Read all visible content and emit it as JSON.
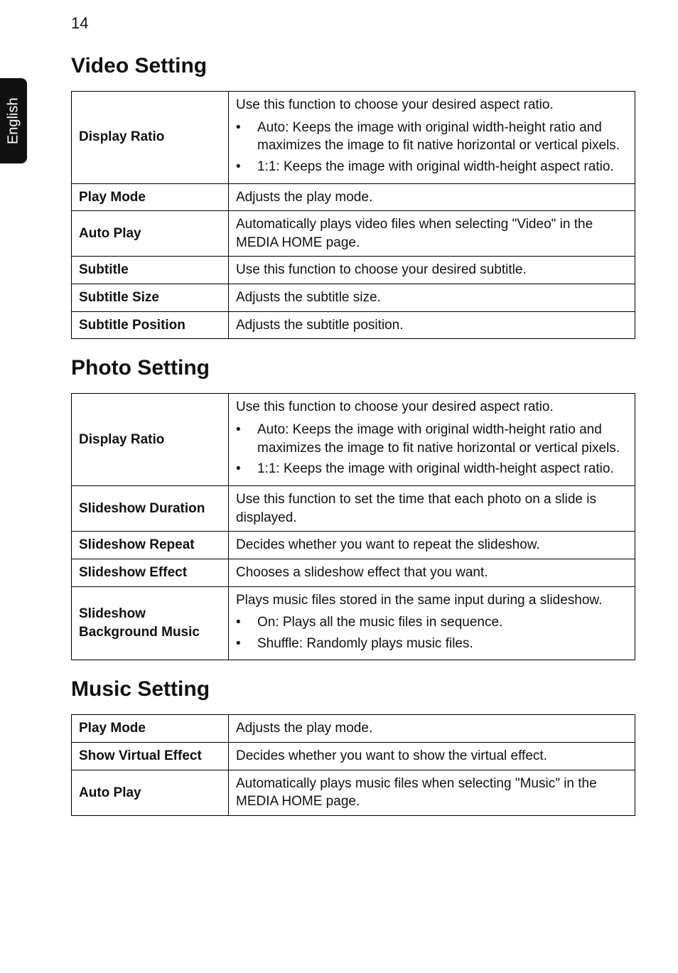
{
  "page_number": "14",
  "side_tab": "English",
  "sections": {
    "video": {
      "heading": "Video Setting",
      "rows": {
        "display_ratio": {
          "label": "Display Ratio",
          "intro": "Use this function to choose your desired aspect ratio.",
          "bullet1": "Auto: Keeps the image with original width-height ratio and maximizes the image to fit native horizontal or vertical pixels.",
          "bullet2": "1:1: Keeps the image with original width-height aspect ratio."
        },
        "play_mode": {
          "label": "Play Mode",
          "desc": "Adjusts the play mode."
        },
        "auto_play": {
          "label": "Auto Play",
          "desc": "Automatically plays video files when selecting \"Video\" in the MEDIA HOME page."
        },
        "subtitle": {
          "label": "Subtitle",
          "desc": "Use this function to choose your desired subtitle."
        },
        "subtitle_size": {
          "label": "Subtitle Size",
          "desc": "Adjusts the subtitle size."
        },
        "subtitle_position": {
          "label": "Subtitle Position",
          "desc": "Adjusts the subtitle position."
        }
      }
    },
    "photo": {
      "heading": "Photo Setting",
      "rows": {
        "display_ratio": {
          "label": "Display Ratio",
          "intro": "Use this function to choose your desired aspect ratio.",
          "bullet1": "Auto: Keeps the image with original width-height ratio and maximizes the image to fit native horizontal or vertical pixels.",
          "bullet2": "1:1: Keeps the image with original width-height aspect ratio."
        },
        "slideshow_duration": {
          "label": "Slideshow Duration",
          "desc": "Use this function to set the time that each photo on a slide is displayed."
        },
        "slideshow_repeat": {
          "label": "Slideshow Repeat",
          "desc": "Decides whether you want to repeat the slideshow."
        },
        "slideshow_effect": {
          "label": "Slideshow Effect",
          "desc": "Chooses a slideshow effect that you want."
        },
        "slideshow_bg_music": {
          "label": "Slideshow Background Music",
          "intro": "Plays music files stored in the same input during a slideshow.",
          "bullet1": "On: Plays all the music files in sequence.",
          "bullet2": "Shuffle: Randomly plays music files."
        }
      }
    },
    "music": {
      "heading": "Music Setting",
      "rows": {
        "play_mode": {
          "label": "Play Mode",
          "desc": "Adjusts the play mode."
        },
        "show_virtual_effect": {
          "label": "Show Virtual Effect",
          "desc": "Decides whether you want to show the virtual effect."
        },
        "auto_play": {
          "label": "Auto Play",
          "desc": "Automatically plays music files when selecting \"Music\" in the MEDIA HOME page."
        }
      }
    }
  }
}
